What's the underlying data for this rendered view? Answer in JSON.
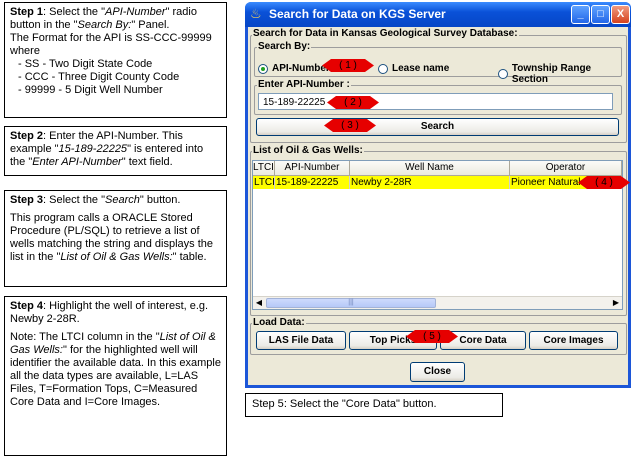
{
  "steps": {
    "s1": {
      "label": "Step 1",
      "t1": ": Select the \"",
      "t1i": "API-Number",
      "t2": "\" radio button in the \"",
      "t2i": "Search By:",
      "t3": "\" Panel.",
      "fmt": "The Format for the API is SS-CCC-99999 where",
      "items": [
        "- SS - Two Digit State Code",
        "- CCC - Three Digit County Code",
        "- 99999 - 5 Digit Well Number"
      ]
    },
    "s2": {
      "label": "Step 2",
      "t1": ": Enter the API-Number. This example \"",
      "t1i": "15-189-22225",
      "t2": "\" is entered into the \"",
      "t2i": "Enter API-Number",
      "t3": "\" text field."
    },
    "s3": {
      "label": "Step 3",
      "t1": ": Select the \"",
      "t1i": "Search",
      "t2": "\" button.",
      "p2a": "This program calls a ORACLE Stored Procedure (PL/SQL) to retrieve a list of wells matching the string and displays the list in the \"",
      "p2i": "List of Oil & Gas Wells:",
      "p2b": "\" table."
    },
    "s4": {
      "label": "Step 4",
      "t1": ": Highlight the well of interest, e.g. Newby 2-28R.",
      "p2a": "Note: The LTCI column in the \"",
      "p2i": "List of Oil & Gas Wells:",
      "p2b": "\" for the highlighted well will identifier the available data. In this example all the data types are available, L=LAS Files, T=Formation Tops, C=Measured Core Data and I=Core Images."
    },
    "s5": {
      "label": "Step 5",
      "t1": ": Select the ",
      "t1i": "\"Core Data\" button."
    }
  },
  "window": {
    "title": "Search for Data on KGS Server",
    "search_group": "Search for Data in Kansas Geological Survey Database:",
    "search_by": "Search By:",
    "radio_api": "API-Number",
    "radio_lease": "Lease name",
    "radio_township": "Township Range Section",
    "enter_api_label": "Enter API-Number :",
    "api_value": "15-189-22225",
    "search_button": "Search",
    "list_group": "List of Oil & Gas Wells:",
    "columns": [
      "LTCI",
      "API-Number",
      "Well Name",
      "Operator"
    ],
    "row": [
      "LTCI",
      "15-189-22225",
      "Newby 2-28R",
      "Pioneer Natural R"
    ],
    "load_group": "Load Data:",
    "load_buttons": [
      "LAS File Data",
      "Top Picks",
      "Core Data",
      "Core Images"
    ],
    "close_button": "Close",
    "minimize_glyph": "_",
    "maximize_glyph": "□",
    "close_glyph": "X",
    "scroll_left": "◀",
    "scroll_right": "▶",
    "scroll_grip": "|||"
  },
  "markers": [
    "( 1 )",
    "( 2 )",
    "( 3 )",
    "( 4 )",
    "( 5 )"
  ],
  "colors": {
    "marker": "#e60000",
    "highlight_row": "#ffff00",
    "titlebar": "#0a51d8"
  }
}
